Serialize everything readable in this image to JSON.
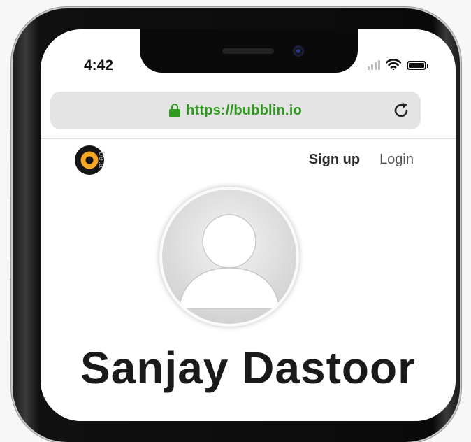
{
  "status_bar": {
    "time": "4:42",
    "icons": [
      "signal-icon",
      "wifi-icon",
      "battery-icon"
    ]
  },
  "browser": {
    "url": "https://bubblin.io",
    "icons": [
      "lock-icon",
      "reload-icon"
    ],
    "url_color": "#2f9a1f"
  },
  "site": {
    "logo_badge": "beta",
    "logo_icon": "bubblin-logo-icon",
    "nav": {
      "signup": "Sign up",
      "login": "Login"
    },
    "accent_color": "#f5a623"
  },
  "profile": {
    "avatar_icon": "default-avatar-icon",
    "name": "Sanjay Dastoor"
  }
}
